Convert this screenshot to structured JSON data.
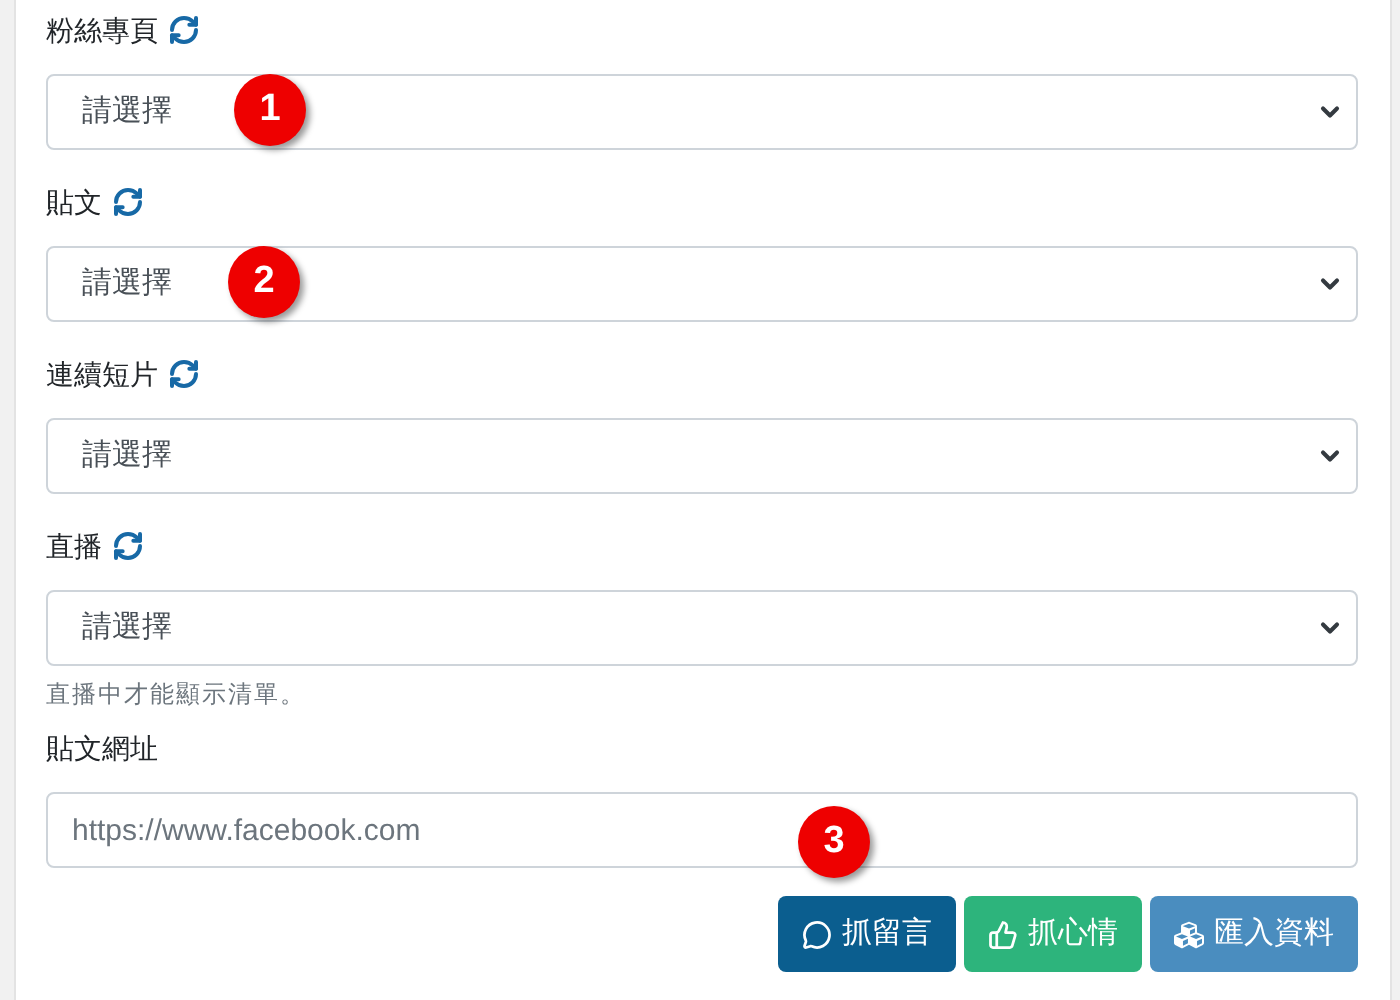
{
  "fields": [
    {
      "kind": "select",
      "label": "粉絲專頁",
      "refresh": true,
      "value": "請選擇",
      "callout": "1"
    },
    {
      "kind": "select",
      "label": "貼文",
      "refresh": true,
      "value": "請選擇",
      "callout": "2"
    },
    {
      "kind": "select",
      "label": "連續短片",
      "refresh": true,
      "value": "請選擇"
    },
    {
      "kind": "select",
      "label": "直播",
      "refresh": true,
      "value": "請選擇",
      "help": "直播中才能顯示清單。"
    },
    {
      "kind": "text",
      "label": "貼文網址",
      "refresh": false,
      "placeholder": "https://www.facebook.com",
      "callout": "3"
    }
  ],
  "buttons": [
    {
      "label": "抓留言",
      "color": "#0b5e8f"
    },
    {
      "label": "抓心情",
      "color": "#2db47c"
    },
    {
      "label": "匯入資料",
      "color": "#4a8dbf"
    }
  ]
}
